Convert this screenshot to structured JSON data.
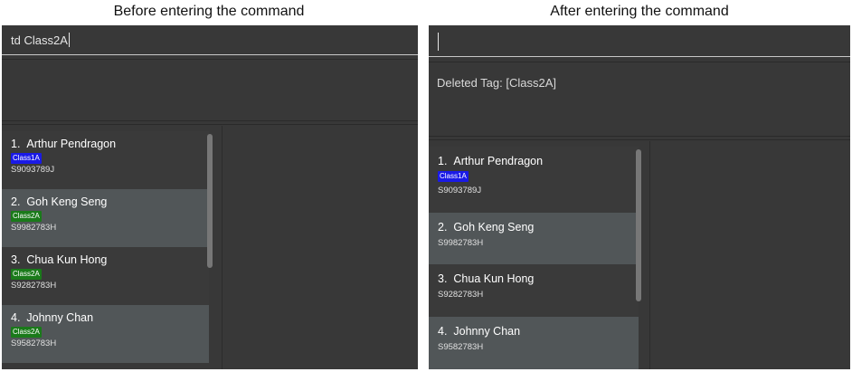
{
  "captions": {
    "before": "Before entering the command",
    "after": "After entering the command"
  },
  "before": {
    "command_value": "td Class2A",
    "result_text": "",
    "persons": [
      {
        "index": "1.",
        "name": "Arthur Pendragon",
        "tag": "Class1A",
        "tag_color": "#1a1ae6",
        "id": "S9093789J"
      },
      {
        "index": "2.",
        "name": "Goh Keng Seng",
        "tag": "Class2A",
        "tag_color": "#1a7a1a",
        "id": "S9982783H"
      },
      {
        "index": "3.",
        "name": "Chua Kun Hong",
        "tag": "Class2A",
        "tag_color": "#1a7a1a",
        "id": "S9282783H"
      },
      {
        "index": "4.",
        "name": "Johnny Chan",
        "tag": "Class2A",
        "tag_color": "#1a7a1a",
        "id": "S9582783H"
      }
    ]
  },
  "after": {
    "command_value": "",
    "result_text": "Deleted Tag: [Class2A]",
    "persons": [
      {
        "index": "1.",
        "name": "Arthur Pendragon",
        "tag": "Class1A",
        "tag_color": "#1a1ae6",
        "id": "S9093789J"
      },
      {
        "index": "2.",
        "name": "Goh Keng Seng",
        "tag": "",
        "id": "S9982783H"
      },
      {
        "index": "3.",
        "name": "Chua Kun Hong",
        "tag": "",
        "id": "S9282783H"
      },
      {
        "index": "4.",
        "name": "Johnny Chan",
        "tag": "",
        "id": "S9582783H"
      }
    ]
  },
  "colors": {
    "app_bg": "#383838",
    "card_alt_bg": "#515658",
    "class1a_tag": "#1a1ae6",
    "class2a_tag": "#1a7a1a"
  }
}
